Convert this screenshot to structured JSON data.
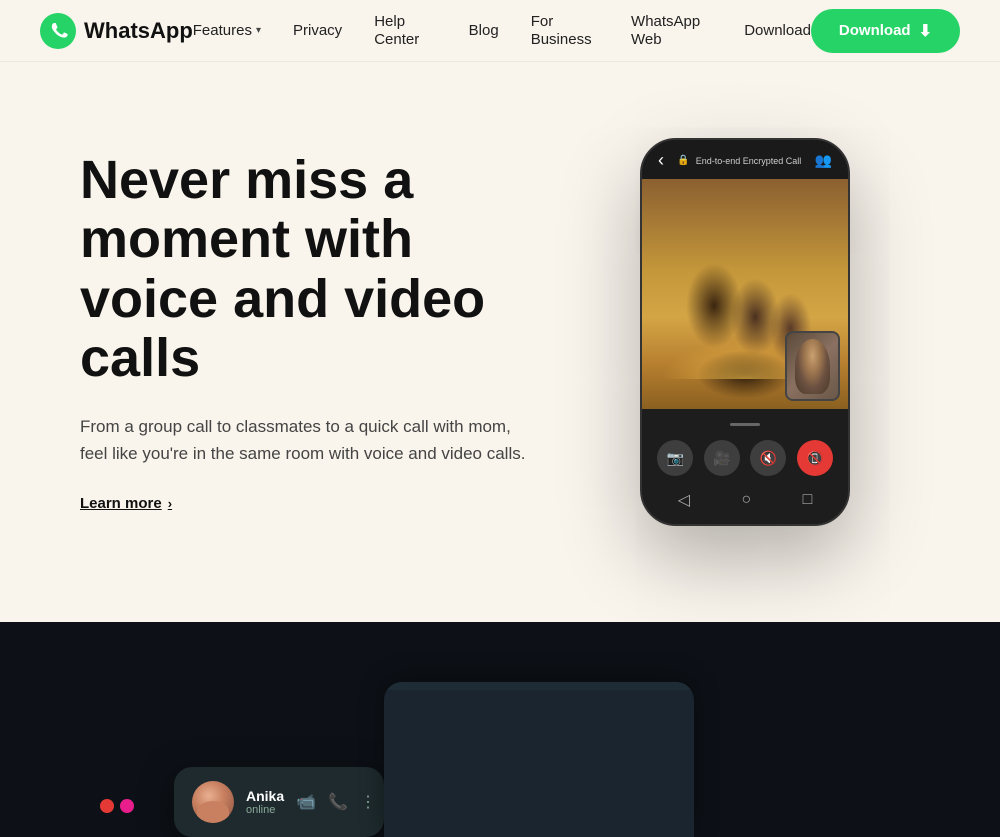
{
  "brand": {
    "name": "WhatsApp",
    "logo_aria": "whatsapp-logo"
  },
  "navbar": {
    "links": [
      {
        "id": "features",
        "label": "Features",
        "has_dropdown": true
      },
      {
        "id": "privacy",
        "label": "Privacy",
        "has_dropdown": false
      },
      {
        "id": "help-center",
        "label": "Help Center",
        "has_dropdown": false
      },
      {
        "id": "blog",
        "label": "Blog",
        "has_dropdown": false
      },
      {
        "id": "for-business",
        "label": "For Business",
        "has_dropdown": false
      },
      {
        "id": "whatsapp-web",
        "label": "WhatsApp Web",
        "has_dropdown": false
      },
      {
        "id": "download-link",
        "label": "Download",
        "has_dropdown": false
      }
    ],
    "cta": {
      "label": "Download",
      "icon": "⬇"
    }
  },
  "hero": {
    "title": "Never miss a moment with voice and video calls",
    "subtitle": "From a group call to classmates to a quick call with mom, feel like you're in the same room with voice and video calls.",
    "learn_more": "Learn more",
    "phone_call_label": "End-to-end Encrypted Call"
  },
  "chat_notification": {
    "name": "Anika",
    "status": "online"
  },
  "dark_section_bg": "#0d1117"
}
